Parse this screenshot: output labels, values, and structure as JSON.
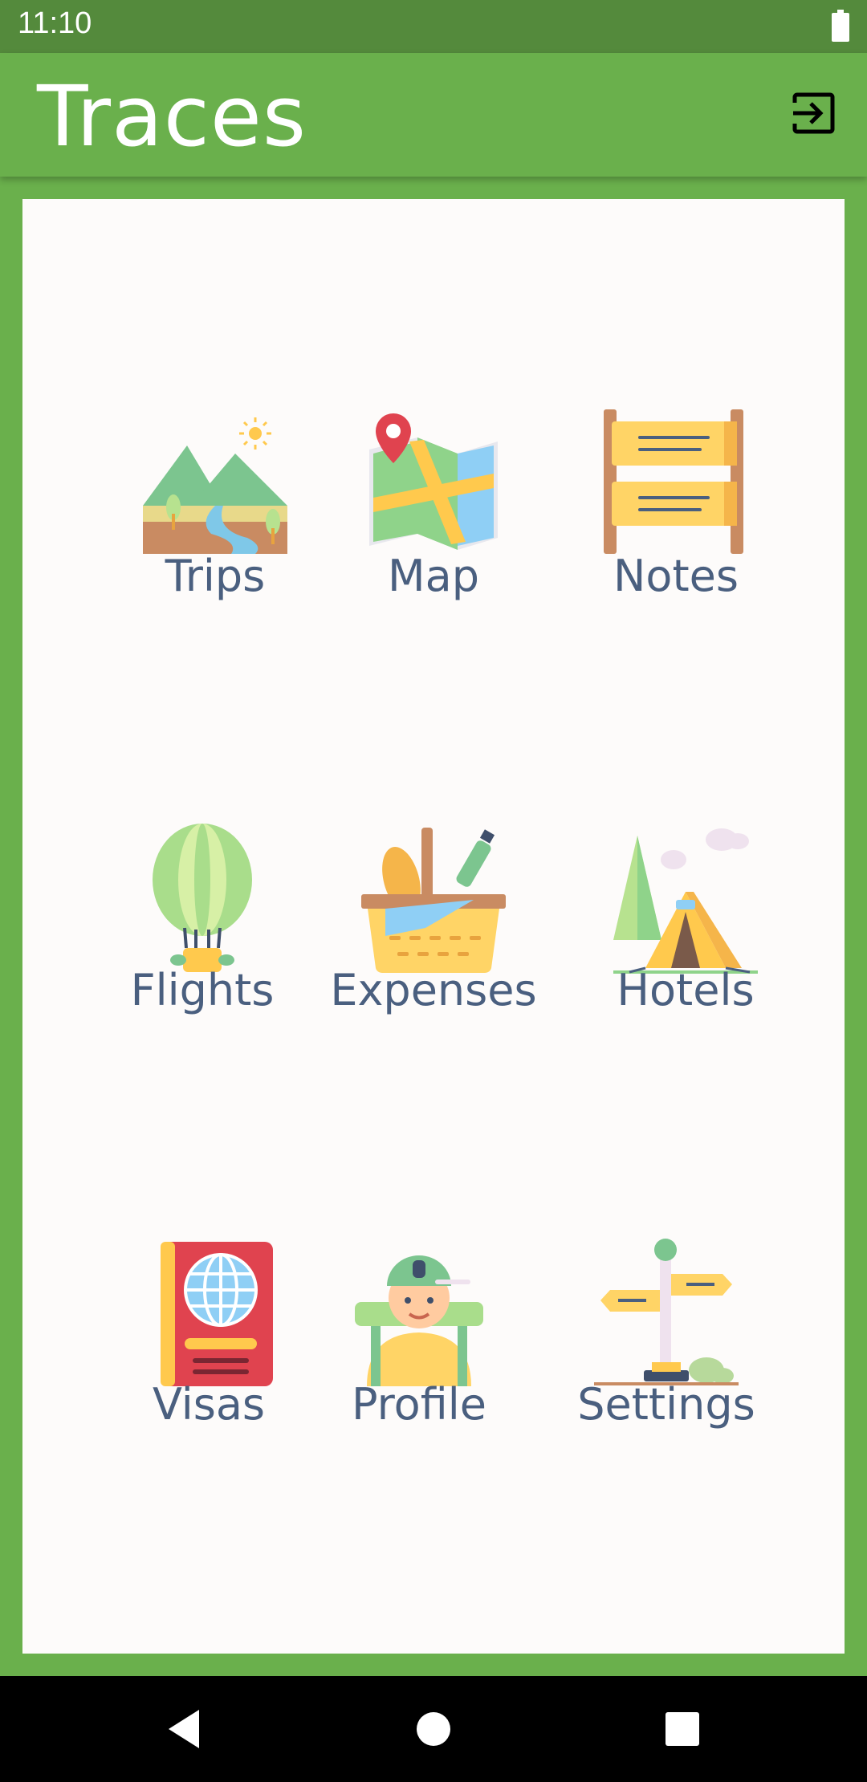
{
  "status_bar": {
    "time": "11:10",
    "battery_icon": "battery-full-icon"
  },
  "app_bar": {
    "title": "Traces",
    "logout_icon": "logout-icon"
  },
  "colors": {
    "primary": "#6ab04c",
    "status": "#548a3c",
    "label": "#4a5f7f",
    "card": "#fdfbfa"
  },
  "menu": {
    "items": [
      {
        "label": "Trips",
        "icon": "mountains-icon"
      },
      {
        "label": "Map",
        "icon": "map-icon"
      },
      {
        "label": "Notes",
        "icon": "notes-board-icon"
      },
      {
        "label": "Flights",
        "icon": "hot-air-balloon-icon"
      },
      {
        "label": "Expenses",
        "icon": "picnic-basket-icon"
      },
      {
        "label": "Hotels",
        "icon": "tent-icon"
      },
      {
        "label": "Visas",
        "icon": "passport-icon"
      },
      {
        "label": "Profile",
        "icon": "traveler-icon"
      },
      {
        "label": "Settings",
        "icon": "signpost-icon"
      }
    ]
  },
  "nav_bar": {
    "back_icon": "back-icon",
    "home_icon": "home-icon",
    "recents_icon": "recents-icon"
  }
}
